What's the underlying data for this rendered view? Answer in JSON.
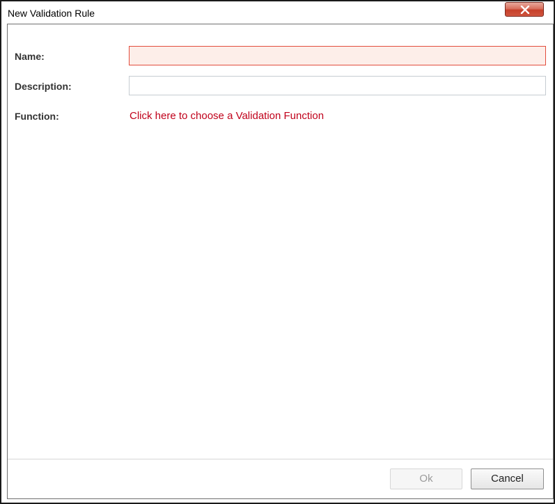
{
  "window": {
    "title": "New Validation Rule",
    "close_icon": "close-icon",
    "close_color": "#c7402a"
  },
  "form": {
    "name": {
      "label": "Name:",
      "value": "",
      "state": "invalid",
      "highlight_color": "#e24c3c"
    },
    "description": {
      "label": "Description:",
      "value": ""
    },
    "function": {
      "label": "Function:",
      "link_text": "Click here to choose a Validation Function",
      "link_color": "#c0001a"
    }
  },
  "footer": {
    "ok_label": "Ok",
    "ok_enabled": false,
    "cancel_label": "Cancel"
  }
}
